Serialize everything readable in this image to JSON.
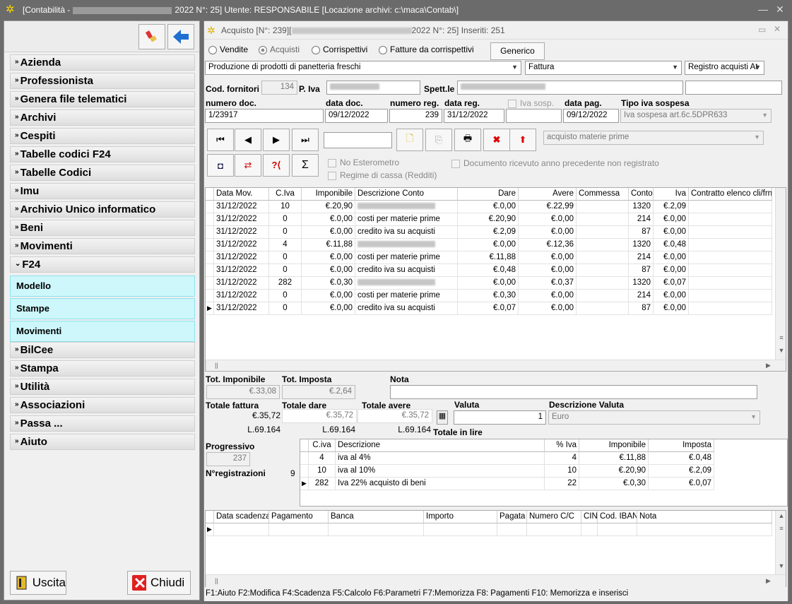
{
  "window": {
    "title_prefix": "[Contabilità -",
    "title_suffix": "2022 N°: 25]  Utente: RESPONSABILE  [Locazione archivi: c:\\maca\\Contab\\]"
  },
  "sidebar": {
    "items": [
      "Azienda",
      "Professionista",
      "Genera file telematici",
      "Archivi",
      "Cespiti",
      "Tabelle codici F24",
      "Tabelle Codici",
      "Imu",
      "Archivio Unico informatico",
      "Beni",
      "Movimenti",
      "F24"
    ],
    "sub_items": [
      "Modello",
      "Stampe",
      "Movimenti"
    ],
    "items_after": [
      "BilCee",
      "Stampa",
      "Utilità",
      "Associazioni",
      "Passa ...",
      "Aiuto"
    ],
    "exit_label": "Uscita",
    "close_label": "Chiudi"
  },
  "form": {
    "header_prefix": "Acquisto [N°: 239][",
    "header_suffix": "2022 N°: 25]   Inseriti: 251",
    "radios": [
      "Vendite",
      "Acquisti",
      "Corrispettivi",
      "Fatture da corrispettivi"
    ],
    "generic_button": "Generico",
    "activity": "Produzione di prodotti di panetteria freschi",
    "doc_type": "Fattura",
    "register": "Registro acquisti At",
    "lbl_cod_fornitori": "Cod. fornitori",
    "cod_fornitori": "134",
    "lbl_piva": "P. Iva",
    "lbl_spett": "Spett.le",
    "lbl_numero_doc": "numero doc.",
    "lbl_data_doc": "data doc.",
    "lbl_numero_reg": "numero reg.",
    "lbl_data_reg": "data reg.",
    "lbl_iva_sosp": "Iva sosp.",
    "lbl_data_pag": "data pag.",
    "lbl_tipo_iva": "Tipo iva sospesa",
    "numero_doc": "1/23917",
    "data_doc": "09/12/2022",
    "numero_reg": "239",
    "data_reg": "31/12/2022",
    "data_pag": "09/12/2022",
    "tipo_iva": "Iva sospesa art.6c.5DPR633",
    "causale": "acquisto materie prime",
    "no_esterometro": "No Esterometro",
    "regime_cassa": "Regime di cassa (Redditi)",
    "doc_ricevuto": "Documento ricevuto anno precedente non registrato"
  },
  "movements": {
    "headers": [
      "Data Mov.",
      "C.Iva",
      "Imponibile",
      "Descrizione Conto",
      "Dare",
      "Avere",
      "Commessa",
      "Conto",
      "Iva",
      "Contratto elenco cli/frn"
    ],
    "rows": [
      {
        "data": "31/12/2022",
        "civa": "10",
        "imp": "€.20,90",
        "desc": "",
        "dare": "€.0,00",
        "avere": "€.22,99",
        "conto": "1320",
        "iva": "€.2,09"
      },
      {
        "data": "31/12/2022",
        "civa": "0",
        "imp": "€.0,00",
        "desc": "costi per materie prime",
        "dare": "€.20,90",
        "avere": "€.0,00",
        "conto": "214",
        "iva": "€.0,00"
      },
      {
        "data": "31/12/2022",
        "civa": "0",
        "imp": "€.0,00",
        "desc": "credito iva su acquisti",
        "dare": "€.2,09",
        "avere": "€.0,00",
        "conto": "87",
        "iva": "€.0,00"
      },
      {
        "data": "31/12/2022",
        "civa": "4",
        "imp": "€.11,88",
        "desc": "",
        "dare": "€.0,00",
        "avere": "€.12,36",
        "conto": "1320",
        "iva": "€.0,48"
      },
      {
        "data": "31/12/2022",
        "civa": "0",
        "imp": "€.0,00",
        "desc": "costi per materie prime",
        "dare": "€.11,88",
        "avere": "€.0,00",
        "conto": "214",
        "iva": "€.0,00"
      },
      {
        "data": "31/12/2022",
        "civa": "0",
        "imp": "€.0,00",
        "desc": "credito iva su acquisti",
        "dare": "€.0,48",
        "avere": "€.0,00",
        "conto": "87",
        "iva": "€.0,00"
      },
      {
        "data": "31/12/2022",
        "civa": "282",
        "imp": "€.0,30",
        "desc": "",
        "dare": "€.0,00",
        "avere": "€.0,37",
        "conto": "1320",
        "iva": "€.0,07"
      },
      {
        "data": "31/12/2022",
        "civa": "0",
        "imp": "€.0,00",
        "desc": "costi per materie prime",
        "dare": "€.0,30",
        "avere": "€.0,00",
        "conto": "214",
        "iva": "€.0,00"
      },
      {
        "data": "31/12/2022",
        "civa": "0",
        "imp": "€.0,00",
        "desc": "credito iva su acquisti",
        "dare": "€.0,07",
        "avere": "€.0,00",
        "conto": "87",
        "iva": "€.0,00"
      }
    ]
  },
  "totals": {
    "lbl_tot_imp": "Tot. Imponibile",
    "lbl_tot_imposta": "Tot. Imposta",
    "lbl_nota": "Nota",
    "tot_imp": "€.33,08",
    "tot_imposta": "€.2,64",
    "lbl_totale_fattura": "Totale fattura",
    "lbl_totale_dare": "Totale dare",
    "lbl_totale_avere": "Totale avere",
    "lbl_valuta": "Valuta",
    "lbl_desc_valuta": "Descrizione Valuta",
    "totale_fattura": "€.35,72",
    "totale_dare": "€.35,72",
    "totale_avere": "€.35,72",
    "lire_fattura": "L.69.164",
    "lire_dare": "L.69.164",
    "lire_avere": "L.69.164",
    "lbl_totale_lire": "Totale in lire",
    "valuta": "1",
    "desc_valuta": "Euro",
    "lbl_progressivo": "Progressivo",
    "progressivo": "237",
    "lbl_nreg": "N°registrazioni",
    "nreg": "9"
  },
  "iva_summary": {
    "headers": [
      "C.iva",
      "Descrizione",
      "% Iva",
      "Imponibile",
      "Imposta"
    ],
    "rows": [
      {
        "civa": "4",
        "desc": "iva al 4%",
        "pct": "4",
        "imp": "€.11,88",
        "imposta": "€.0,48"
      },
      {
        "civa": "10",
        "desc": "iva al 10%",
        "pct": "10",
        "imp": "€.20,90",
        "imposta": "€.2,09"
      },
      {
        "civa": "282",
        "desc": "Iva 22% acquisto di beni",
        "pct": "22",
        "imp": "€.0,30",
        "imposta": "€.0,07"
      }
    ]
  },
  "payments": {
    "headers": [
      "Data scadenza",
      "Pagamento",
      "Banca",
      "Importo",
      "Pagata",
      "Numero C/C",
      "CIN",
      "Cod. IBAN",
      "Nota"
    ]
  },
  "statusbar": "F1:Aiuto F2:Modifica F4:Scadenza F5:Calcolo F6:Parametri F7:Memorizza F8: Pagamenti F10: Memorizza e inserisci"
}
